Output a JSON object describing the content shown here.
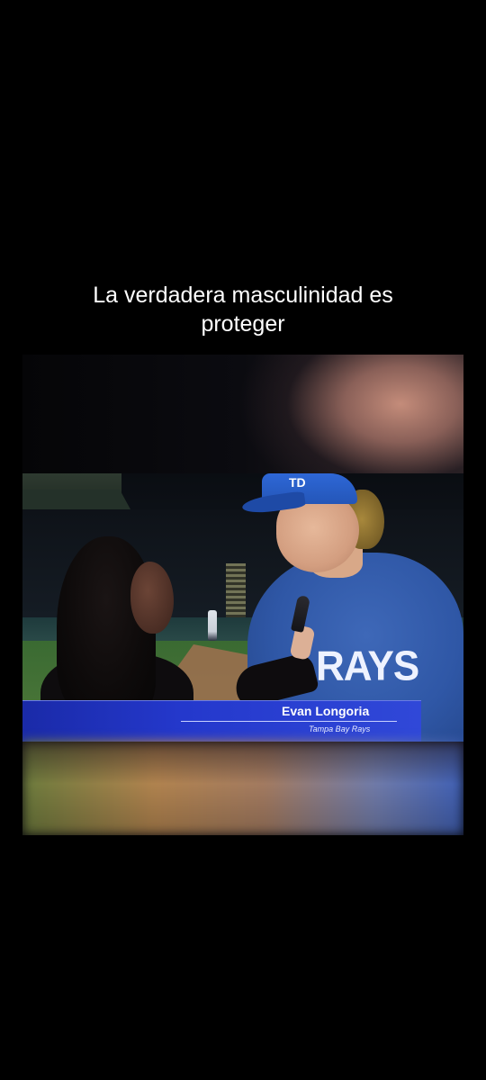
{
  "caption": {
    "line1": "La verdadera masculinidad es",
    "line2": "proteger"
  },
  "video": {
    "lower_third": {
      "name": "Evan Longoria",
      "team": "Tampa Bay Rays"
    },
    "jersey_text": "RAYS",
    "cap_logo": "TD"
  }
}
